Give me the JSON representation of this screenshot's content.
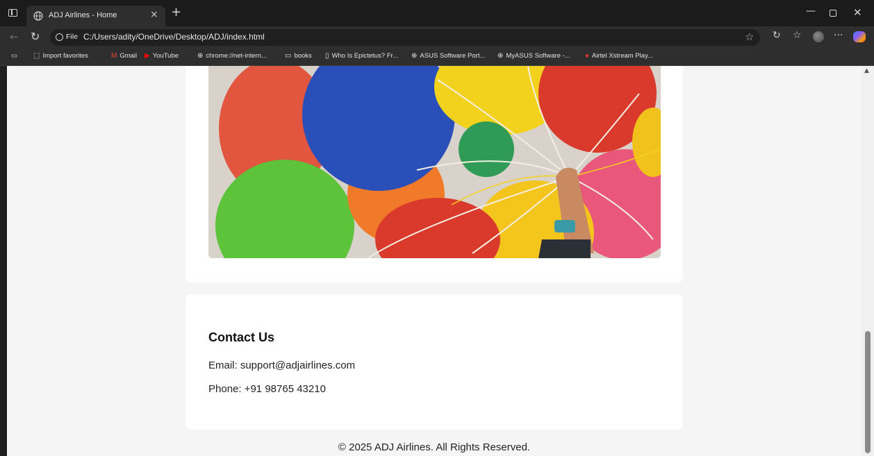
{
  "browser": {
    "tab_title": "ADJ Airlines - Home",
    "tab_close": "×",
    "new_tab": "+",
    "scheme_label": "File",
    "url": "C:/Users/adity/OneDrive/Desktop/ADJ/index.html",
    "window_controls": {
      "minimize": "—",
      "close": "✕"
    },
    "toolbar_icons": [
      "star-icon",
      "refresh-icon",
      "favorites-icon",
      "profile-avatar",
      "more-icon",
      "copilot-icon"
    ],
    "more_label": "···"
  },
  "bookmarks": [
    {
      "label": "Import favorites",
      "icon": "import-icon"
    },
    {
      "label": "Gmail",
      "icon": "gmail-icon"
    },
    {
      "label": "YouTube",
      "icon": "youtube-icon"
    },
    {
      "label": "chrome://net-intern...",
      "icon": "globe-icon"
    },
    {
      "label": "books",
      "icon": "folder-icon"
    },
    {
      "label": "Who Is Epictetus? Fr...",
      "icon": "page-icon"
    },
    {
      "label": "ASUS Software Port...",
      "icon": "globe-icon"
    },
    {
      "label": "MyASUS Software -...",
      "icon": "globe-icon"
    },
    {
      "label": "Airtel Xstream Play...",
      "icon": "airtel-icon"
    }
  ],
  "contact": {
    "title": "Contact Us",
    "email": "Email: support@adjairlines.com",
    "phone": "Phone: +91 98765 43210"
  },
  "footer": {
    "text": "© 2025 ADJ Airlines. All Rights Reserved."
  },
  "colors": {
    "page_bg": "#f5f5f5",
    "card_bg": "#ffffff",
    "chrome_dark": "#1b1b1b",
    "chrome_mid": "#2e2e2e"
  }
}
